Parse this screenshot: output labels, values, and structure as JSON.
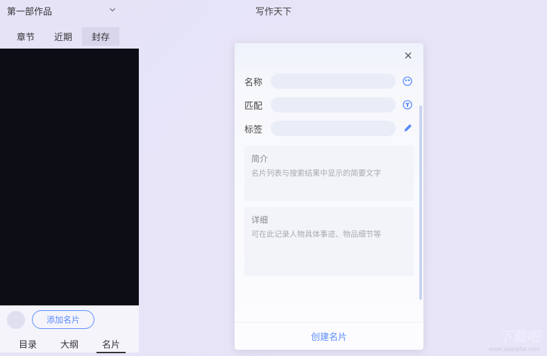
{
  "app_title": "写作天下",
  "work_selector": "第一部作品",
  "top_tabs": {
    "chapter": "章节",
    "recent": "近期",
    "sealed": "封存"
  },
  "add_card_button": "添加名片",
  "bottom_tabs": {
    "toc": "目录",
    "outline": "大纲",
    "card": "名片"
  },
  "modal": {
    "fields": {
      "name_label": "名称",
      "match_label": "匹配",
      "tag_label": "标签"
    },
    "brief": {
      "title": "简介",
      "hint": "名片列表与搜索结果中显示的简要文字"
    },
    "detail": {
      "title": "详细",
      "hint": "可在此记录人物具体事迹、物品细节等"
    },
    "create_button": "创建名片"
  },
  "watermark": "下载吧",
  "watermark_url": "www.xiazaiba.com"
}
